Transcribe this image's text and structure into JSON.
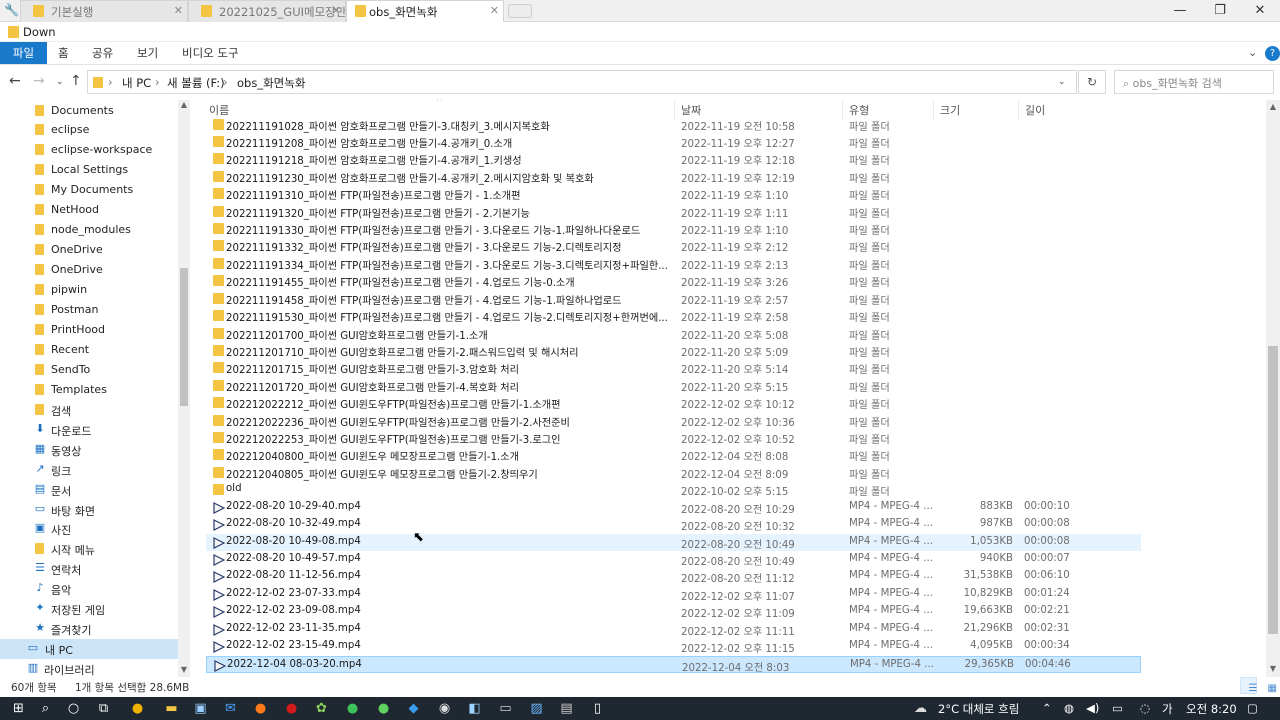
{
  "window": {
    "tabs": [
      {
        "label": "기본실행"
      },
      {
        "label": "20221025_GUI메모장만들"
      },
      {
        "label": "obs_화면녹화"
      }
    ],
    "address_strip": "Down",
    "minimize_icon": "minimize-icon",
    "maximize_icon": "maximize-icon",
    "close_icon": "close-icon"
  },
  "ribbon": {
    "file": "파일",
    "home": "홈",
    "share": "공유",
    "view": "보기",
    "video_tools": "비디오 도구",
    "help": "?"
  },
  "navigation": {
    "breadcrumb": [
      "내 PC",
      "새 볼륨 (F:)",
      "obs_화면녹화"
    ],
    "search_placeholder": "obs_화면녹화 검색"
  },
  "sidebar": {
    "items": [
      {
        "label": "Documents",
        "icon": "folder"
      },
      {
        "label": "eclipse",
        "icon": "folder"
      },
      {
        "label": "eclipse-workspace",
        "icon": "folder"
      },
      {
        "label": "Local Settings",
        "icon": "folder"
      },
      {
        "label": "My Documents",
        "icon": "folder"
      },
      {
        "label": "NetHood",
        "icon": "folder"
      },
      {
        "label": "node_modules",
        "icon": "folder"
      },
      {
        "label": "OneDrive",
        "icon": "folder"
      },
      {
        "label": "OneDrive",
        "icon": "folder"
      },
      {
        "label": "pipwin",
        "icon": "folder"
      },
      {
        "label": "Postman",
        "icon": "folder"
      },
      {
        "label": "PrintHood",
        "icon": "folder"
      },
      {
        "label": "Recent",
        "icon": "folder"
      },
      {
        "label": "SendTo",
        "icon": "folder"
      },
      {
        "label": "Templates",
        "icon": "folder"
      },
      {
        "label": "검색",
        "icon": "folder"
      },
      {
        "label": "다운로드",
        "icon": "download"
      },
      {
        "label": "동영상",
        "icon": "video"
      },
      {
        "label": "링크",
        "icon": "link"
      },
      {
        "label": "문서",
        "icon": "document"
      },
      {
        "label": "바탕 화면",
        "icon": "desktop"
      },
      {
        "label": "사진",
        "icon": "picture"
      },
      {
        "label": "시작 메뉴",
        "icon": "folder"
      },
      {
        "label": "연락처",
        "icon": "contacts"
      },
      {
        "label": "음악",
        "icon": "music"
      },
      {
        "label": "저장된 게임",
        "icon": "game"
      },
      {
        "label": "즐겨찾기",
        "icon": "star"
      },
      {
        "label": "내 PC",
        "icon": "pc"
      },
      {
        "label": "라이브러리",
        "icon": "library"
      }
    ]
  },
  "columns": {
    "name": "이름",
    "date": "날짜",
    "type": "유형",
    "size": "크기",
    "length": "길이"
  },
  "files": [
    {
      "name": "202211191028_파이썬 암호화프로그램 만들기-3.대칭키_3.메시지복호화",
      "date": "2022-11-19 오전 10:58",
      "type": "파일 폴더",
      "size": "",
      "length": "",
      "kind": "folder"
    },
    {
      "name": "202211191208_파이썬 암호화프로그램 만들기-4.공개키_0.소개",
      "date": "2022-11-19 오후 12:27",
      "type": "파일 폴더",
      "size": "",
      "length": "",
      "kind": "folder"
    },
    {
      "name": "202211191218_파이썬 암호화프로그램 만들기-4.공개키_1.키생성",
      "date": "2022-11-19 오후 12:18",
      "type": "파일 폴더",
      "size": "",
      "length": "",
      "kind": "folder"
    },
    {
      "name": "202211191230_파이썬 암호화프로그램 만들기-4.공개키_2.메시지암호화 및 복호화",
      "date": "2022-11-19 오후 12:19",
      "type": "파일 폴더",
      "size": "",
      "length": "",
      "kind": "folder"
    },
    {
      "name": "202211191310_파이썬 FTP(파일전송)프로그램 만들기 - 1.소개편",
      "date": "2022-11-19 오후 1:10",
      "type": "파일 폴더",
      "size": "",
      "length": "",
      "kind": "folder"
    },
    {
      "name": "202211191320_파이썬 FTP(파일전송)프로그램 만들기 - 2.기본기능",
      "date": "2022-11-19 오후 1:11",
      "type": "파일 폴더",
      "size": "",
      "length": "",
      "kind": "folder"
    },
    {
      "name": "202211191330_파이썬 FTP(파일전송)프로그램 만들기 - 3.다운로드 기능-1.파일하나다운로드",
      "date": "2022-11-19 오후 1:10",
      "type": "파일 폴더",
      "size": "",
      "length": "",
      "kind": "folder"
    },
    {
      "name": "202211191332_파이썬 FTP(파일전송)프로그램 만들기 - 3.다운로드 기능-2.디렉토리지정",
      "date": "2022-11-19 오후 2:12",
      "type": "파일 폴더",
      "size": "",
      "length": "",
      "kind": "folder"
    },
    {
      "name": "202211191334_파이썬 FTP(파일전송)프로그램 만들기 - 3.다운로드 기능-3.디렉토리지정+파일한...",
      "date": "2022-11-19 오후 2:13",
      "type": "파일 폴더",
      "size": "",
      "length": "",
      "kind": "folder"
    },
    {
      "name": "202211191455_파이썬 FTP(파일전송)프로그램 만들기 - 4.업로드 기능-0.소개",
      "date": "2022-11-19 오후 3:26",
      "type": "파일 폴더",
      "size": "",
      "length": "",
      "kind": "folder"
    },
    {
      "name": "202211191458_파이썬 FTP(파일전송)프로그램 만들기 - 4.업로드 기능-1.파일하나업로드",
      "date": "2022-11-19 오후 2:57",
      "type": "파일 폴더",
      "size": "",
      "length": "",
      "kind": "folder"
    },
    {
      "name": "202211191530_파이썬 FTP(파일전송)프로그램 만들기 - 4.업로드 기능-2.디렉토리지정+한꺼번에...",
      "date": "2022-11-19 오후 2:58",
      "type": "파일 폴더",
      "size": "",
      "length": "",
      "kind": "folder"
    },
    {
      "name": "202211201700_파이썬 GUI암호화프로그램 만들기-1.소개",
      "date": "2022-11-20 오후 5:08",
      "type": "파일 폴더",
      "size": "",
      "length": "",
      "kind": "folder"
    },
    {
      "name": "202211201710_파이썬 GUI암호화프로그램 만들기-2.패스워드입력 및 해시처리",
      "date": "2022-11-20 오후 5:09",
      "type": "파일 폴더",
      "size": "",
      "length": "",
      "kind": "folder"
    },
    {
      "name": "202211201715_파이썬 GUI암호화프로그램 만들기-3.암호화 처리",
      "date": "2022-11-20 오후 5:14",
      "type": "파일 폴더",
      "size": "",
      "length": "",
      "kind": "folder"
    },
    {
      "name": "202211201720_파이썬 GUI암호화프로그램 만들기-4.복호화 처리",
      "date": "2022-11-20 오후 5:15",
      "type": "파일 폴더",
      "size": "",
      "length": "",
      "kind": "folder"
    },
    {
      "name": "202212022212_파이썬 GUI윈도우FTP(파일전송)프로그램 만들기-1.소개편",
      "date": "2022-12-02 오후 10:12",
      "type": "파일 폴더",
      "size": "",
      "length": "",
      "kind": "folder"
    },
    {
      "name": "202212022236_파이썬 GUI윈도우FTP(파일전송)프로그램 만들기-2.사전준비",
      "date": "2022-12-02 오후 10:36",
      "type": "파일 폴더",
      "size": "",
      "length": "",
      "kind": "folder"
    },
    {
      "name": "202212022253_파이썬 GUI윈도우FTP(파일전송)프로그램 만들기-3.로그인",
      "date": "2022-12-02 오후 10:52",
      "type": "파일 폴더",
      "size": "",
      "length": "",
      "kind": "folder"
    },
    {
      "name": "202212040800_파이썬 GUI윈도우 메모장프로그램 만들기-1.소개",
      "date": "2022-12-04 오전 8:08",
      "type": "파일 폴더",
      "size": "",
      "length": "",
      "kind": "folder"
    },
    {
      "name": "202212040805_파이썬 GUI윈도우 메모장프로그램 만들기-2.창띄우기",
      "date": "2022-12-04 오전 8:09",
      "type": "파일 폴더",
      "size": "",
      "length": "",
      "kind": "folder"
    },
    {
      "name": "old",
      "date": "2022-10-02 오후 5:15",
      "type": "파일 폴더",
      "size": "",
      "length": "",
      "kind": "folder"
    },
    {
      "name": "2022-08-20 10-29-40.mp4",
      "date": "2022-08-20 오전 10:29",
      "type": "MP4 - MPEG-4 ...",
      "size": "883KB",
      "length": "00:00:10",
      "kind": "video"
    },
    {
      "name": "2022-08-20 10-32-49.mp4",
      "date": "2022-08-20 오전 10:32",
      "type": "MP4 - MPEG-4 ...",
      "size": "987KB",
      "length": "00:00:08",
      "kind": "video"
    },
    {
      "name": "2022-08-20 10-49-08.mp4",
      "date": "2022-08-20 오전 10:49",
      "type": "MP4 - MPEG-4 ...",
      "size": "1,053KB",
      "length": "00:00:08",
      "kind": "video",
      "state": "hover"
    },
    {
      "name": "2022-08-20 10-49-57.mp4",
      "date": "2022-08-20 오전 10:49",
      "type": "MP4 - MPEG-4 ...",
      "size": "940KB",
      "length": "00:00:07",
      "kind": "video"
    },
    {
      "name": "2022-08-20 11-12-56.mp4",
      "date": "2022-08-20 오전 11:12",
      "type": "MP4 - MPEG-4 ...",
      "size": "31,538KB",
      "length": "00:06:10",
      "kind": "video"
    },
    {
      "name": "2022-12-02 23-07-33.mp4",
      "date": "2022-12-02 오후 11:07",
      "type": "MP4 - MPEG-4 ...",
      "size": "10,829KB",
      "length": "00:01:24",
      "kind": "video"
    },
    {
      "name": "2022-12-02 23-09-08.mp4",
      "date": "2022-12-02 오후 11:09",
      "type": "MP4 - MPEG-4 ...",
      "size": "19,663KB",
      "length": "00:02:21",
      "kind": "video"
    },
    {
      "name": "2022-12-02 23-11-35.mp4",
      "date": "2022-12-02 오후 11:11",
      "type": "MP4 - MPEG-4 ...",
      "size": "21,296KB",
      "length": "00:02:31",
      "kind": "video"
    },
    {
      "name": "2022-12-02 23-15-49.mp4",
      "date": "2022-12-02 오후 11:15",
      "type": "MP4 - MPEG-4 ...",
      "size": "4,095KB",
      "length": "00:00:34",
      "kind": "video"
    },
    {
      "name": "2022-12-04 08-03-20.mp4",
      "date": "2022-12-04 오전 8:03",
      "type": "MP4 - MPEG-4 ...",
      "size": "29,365KB",
      "length": "00:04:46",
      "kind": "video",
      "state": "selected"
    }
  ],
  "status": {
    "item_count": "60개 항목",
    "selection": "1개 항목 선택함 28.6MB"
  },
  "taskbar": {
    "weather": "2°C 대체로 흐림",
    "ime": "가",
    "time": "오전 8:20"
  },
  "colors": {
    "accent": "#1979ca",
    "folder": "#f4c542",
    "selected_row": "#cce8ff",
    "hover_row": "#e5f3ff",
    "taskbar": "#1f2731"
  }
}
